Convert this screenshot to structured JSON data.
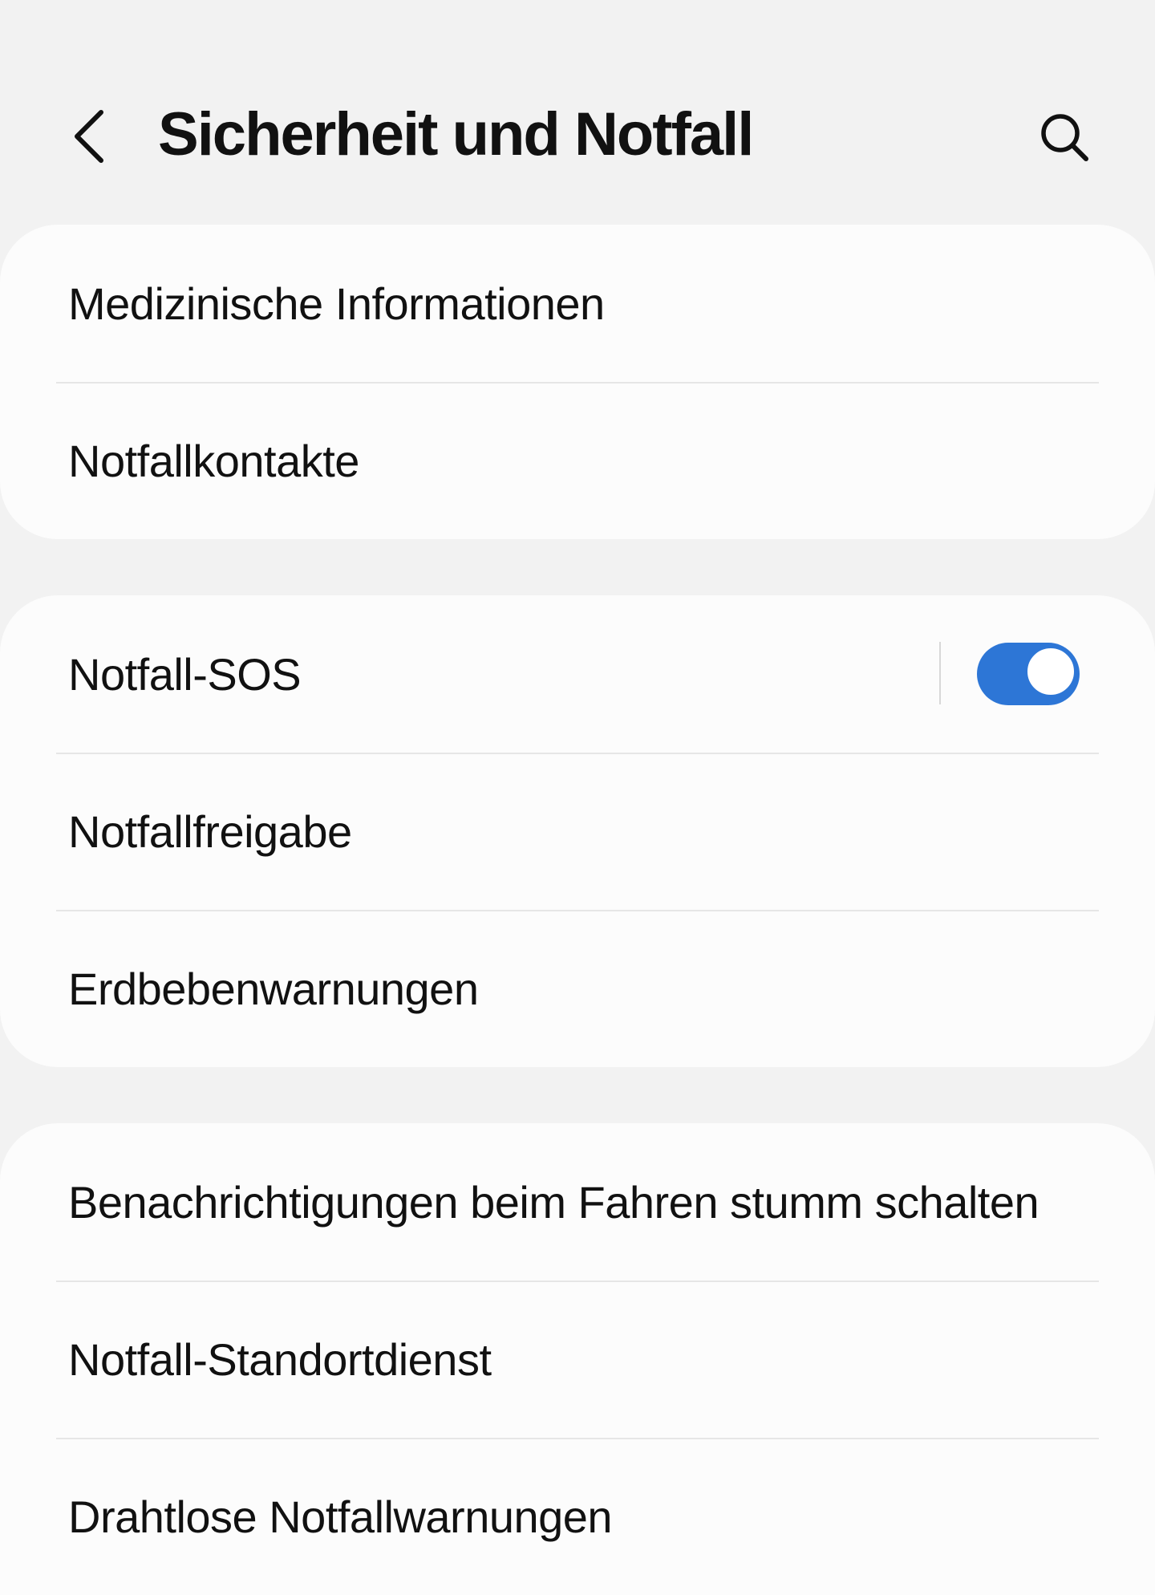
{
  "header": {
    "title": "Sicherheit und Notfall",
    "back_icon": "chevron-left-icon",
    "search_icon": "search-icon"
  },
  "groups": [
    {
      "items": [
        {
          "label": "Medizinische Informationen"
        },
        {
          "label": "Notfallkontakte"
        }
      ]
    },
    {
      "items": [
        {
          "label": "Notfall-SOS",
          "toggle": true,
          "toggle_on": true
        },
        {
          "label": "Notfallfreigabe"
        },
        {
          "label": "Erdbebenwarnungen"
        }
      ]
    },
    {
      "items": [
        {
          "label": "Benachrichtigungen beim Fahren stumm schalten"
        },
        {
          "label": "Notfall-Standortdienst"
        },
        {
          "label": "Drahtlose Notfallwarnungen"
        }
      ]
    }
  ],
  "colors": {
    "background": "#f2f2f2",
    "card": "#fcfcfc",
    "text": "#111111",
    "divider": "#e6e6e6",
    "accent": "#2d76d6"
  }
}
